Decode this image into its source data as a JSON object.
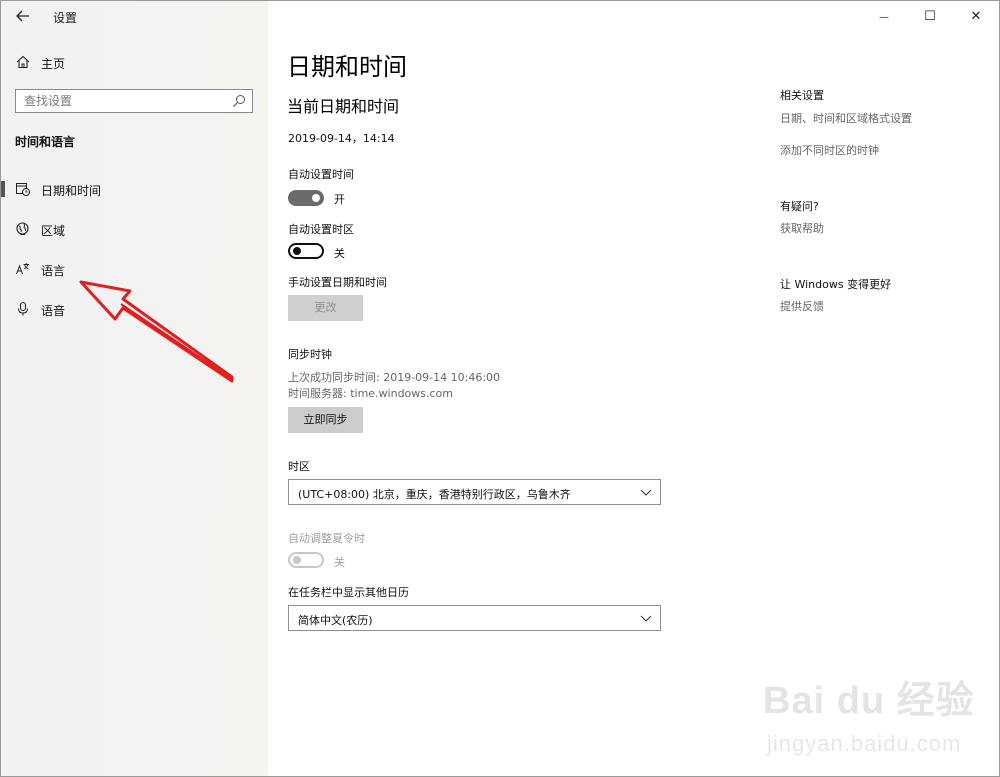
{
  "window": {
    "app_title": "设置",
    "back_icon": "arrow-left-icon",
    "minimize_glyph": "—",
    "maximize_glyph": "☐",
    "close_glyph": "✕"
  },
  "sidebar": {
    "home_label": "主页",
    "search_placeholder": "查找设置",
    "section_heading": "时间和语言",
    "items": [
      {
        "label": "日期和时间",
        "icon": "calendar-clock-icon",
        "selected": true
      },
      {
        "label": "区域",
        "icon": "globe-icon",
        "selected": false
      },
      {
        "label": "语言",
        "icon": "language-icon",
        "selected": false
      },
      {
        "label": "语音",
        "icon": "microphone-icon",
        "selected": false
      }
    ]
  },
  "main": {
    "page_title": "日期和时间",
    "current_section": "当前日期和时间",
    "current_datetime": "2019-09-14，14:14",
    "auto_time": {
      "label": "自动设置时间",
      "state": "开",
      "on": true
    },
    "auto_timezone": {
      "label": "自动设置时区",
      "state": "关",
      "on": false
    },
    "manual": {
      "label": "手动设置日期和时间",
      "button": "更改"
    },
    "sync": {
      "heading": "同步时钟",
      "last_sync": "上次成功同步时间: 2019-09-14 10:46:00",
      "server": "时间服务器: time.windows.com",
      "button": "立即同步"
    },
    "timezone": {
      "label": "时区",
      "value": "(UTC+08:00) 北京，重庆，香港特别行政区，乌鲁木齐"
    },
    "dst": {
      "label": "自动调整夏令时",
      "state": "关",
      "enabled": false
    },
    "calendar": {
      "label": "在任务栏中显示其他日历",
      "value": "简体中文(农历)"
    }
  },
  "related": {
    "heading": "相关设置",
    "links": [
      "日期、时间和区域格式设置",
      "添加不同时区的时钟"
    ],
    "help_heading": "有疑问?",
    "help_link": "获取帮助",
    "feedback_heading": "让 Windows 变得更好",
    "feedback_link": "提供反馈"
  },
  "watermark": {
    "brand": "Bai du 经验",
    "url": "jingyan.baidu.com"
  },
  "colors": {
    "annotation_arrow": "#e02020",
    "toggle_on": "#6b6b6b",
    "button_bg": "#cccccc"
  }
}
